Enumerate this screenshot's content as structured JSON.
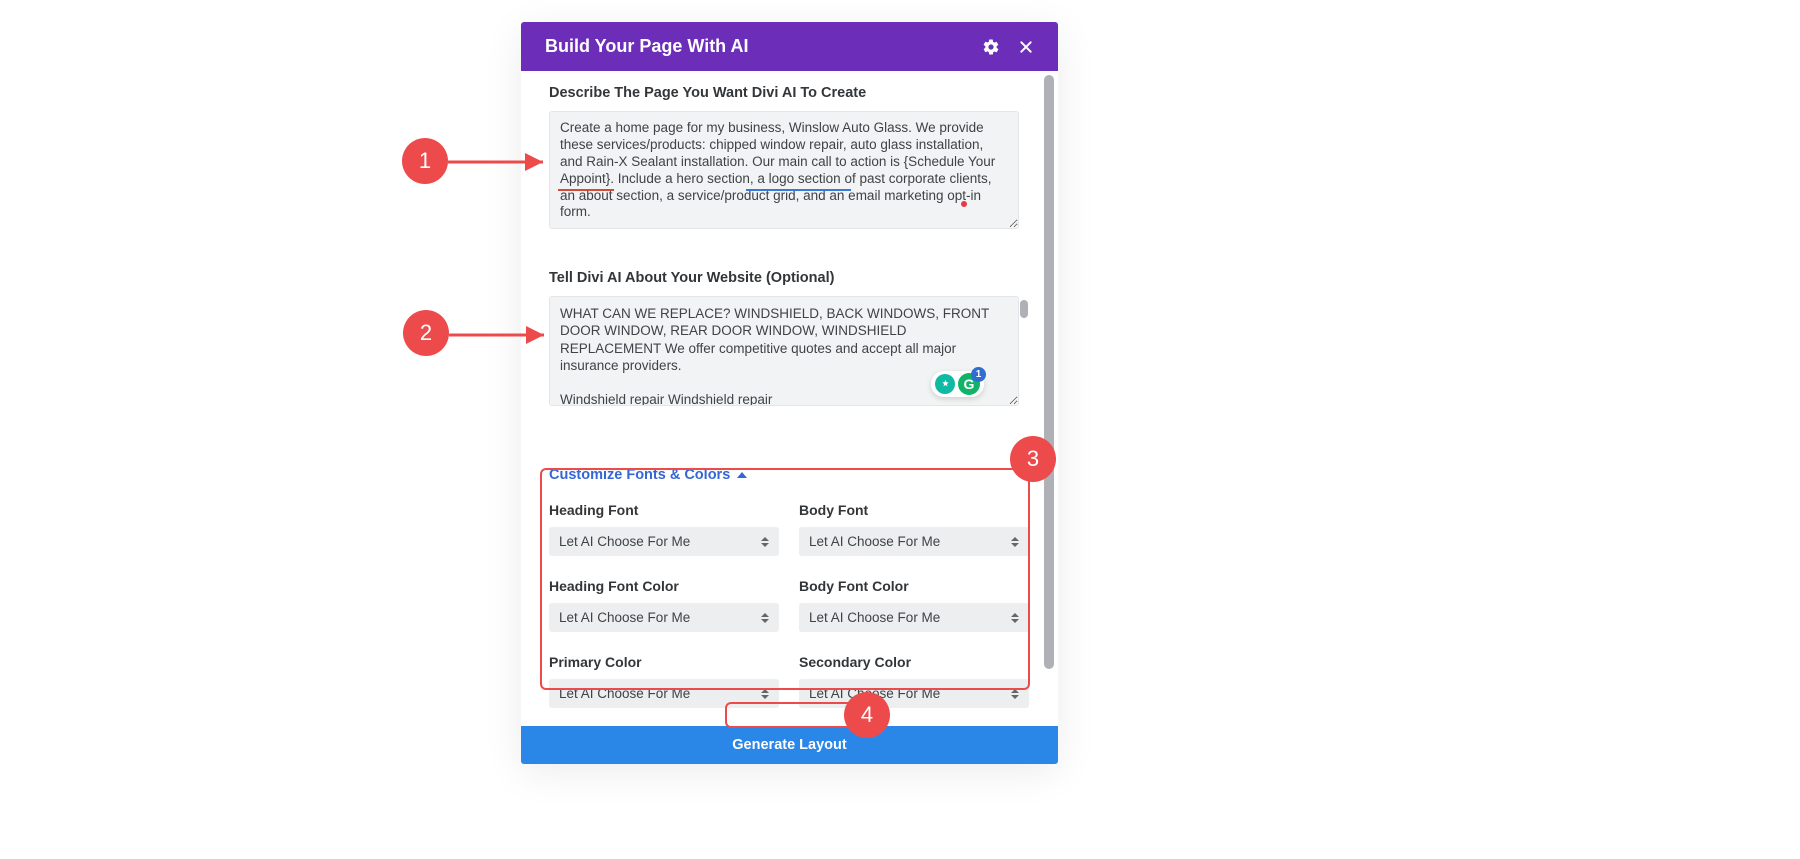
{
  "modal": {
    "title": "Build Your Page With AI",
    "describe_label": "Describe The Page You Want Divi AI To Create",
    "describe_value": "Create a home page for my business, Winslow Auto Glass. We provide these services/products: chipped window repair, auto glass installation, and Rain-X Sealant installation. Our main call to action is {Schedule Your Appoint}. Include a hero section, a logo section of past corporate clients, an about section, a service/product grid, and an email marketing opt-in form.",
    "website_label": "Tell Divi AI About Your Website (Optional)",
    "website_value": "WHAT CAN WE REPLACE? WINDSHIELD, BACK WINDOWS, FRONT DOOR WINDOW, REAR DOOR WINDOW, WINDSHIELD REPLACEMENT We offer competitive quotes and accept all major insurance providers.\n\nWindshield repair Windshield repair",
    "customize_label": "Customize Fonts & Colors",
    "fields": {
      "heading_font": {
        "label": "Heading Font",
        "value": "Let AI Choose For Me"
      },
      "body_font": {
        "label": "Body Font",
        "value": "Let AI Choose For Me"
      },
      "heading_font_color": {
        "label": "Heading Font Color",
        "value": "Let AI Choose For Me"
      },
      "body_font_color": {
        "label": "Body Font Color",
        "value": "Let AI Choose For Me"
      },
      "primary_color": {
        "label": "Primary Color",
        "value": "Let AI Choose For Me"
      },
      "secondary_color": {
        "label": "Secondary Color",
        "value": "Let AI Choose For Me"
      }
    },
    "generate_label": "Generate Layout",
    "grammarly_count": "1"
  },
  "annotations": {
    "n1": "1",
    "n2": "2",
    "n3": "3",
    "n4": "4"
  }
}
